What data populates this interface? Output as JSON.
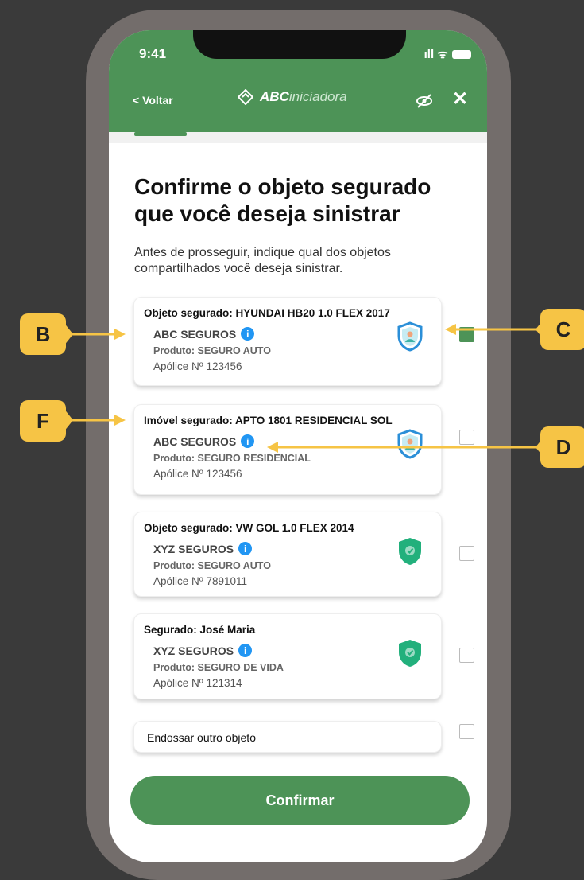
{
  "status": {
    "time": "9:41",
    "signal": "ıll ᯤ"
  },
  "nav": {
    "back": "< Voltar",
    "brand_bold": "ABC",
    "brand_light": "iniciadora"
  },
  "title": "Confirme o objeto segurado que você deseja sinistrar",
  "description": "Antes de prosseguir, indique qual dos objetos compartilhados você deseja sinistrar.",
  "cards": [
    {
      "head": "Objeto segurado: HYUNDAI HB20 1.0 FLEX 2017",
      "insurer": "ABC SEGUROS",
      "product": "Produto: SEGURO AUTO",
      "policy": "Apólice Nº 123456",
      "shield": "blue-shield-icon",
      "checked": true
    },
    {
      "head": "Imóvel segurado: APTO 1801 RESIDENCIAL SOL",
      "insurer": "ABC SEGUROS",
      "product": "Produto: SEGURO RESIDENCIAL",
      "policy": "Apólice Nº 123456",
      "shield": "blue-shield-icon",
      "checked": false
    },
    {
      "head": "Objeto segurado: VW GOL 1.0 FLEX 2014",
      "insurer": "XYZ SEGUROS",
      "product": "Produto: SEGURO AUTO",
      "policy": "Apólice Nº 7891011",
      "shield": "green-shield-icon",
      "checked": false
    },
    {
      "head": "Segurado: José Maria",
      "insurer": "XYZ SEGUROS",
      "product": "Produto: SEGURO DE VIDA",
      "policy": "Apólice Nº 121314",
      "shield": "green-shield-icon",
      "checked": false
    }
  ],
  "other_option": "Endossar outro objeto",
  "confirm_label": "Confirmar",
  "callouts": {
    "b": "B",
    "c": "C",
    "f": "F",
    "d": "D"
  },
  "colors": {
    "brand_green": "#4d9357",
    "callout_yellow": "#f6c445",
    "info_blue": "#2196f3"
  }
}
